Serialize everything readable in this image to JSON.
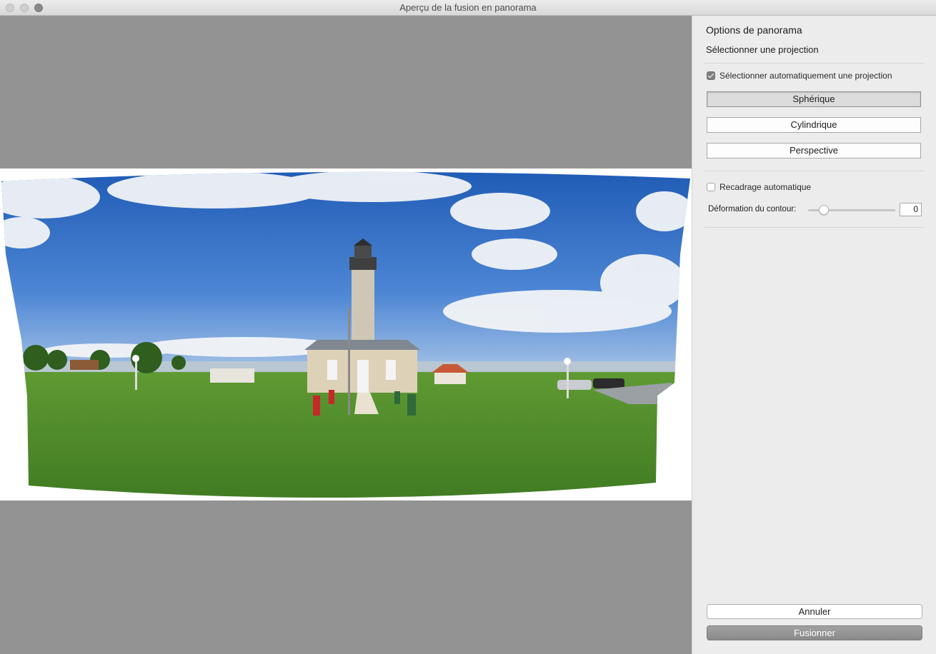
{
  "window": {
    "title": "Aperçu de la fusion en panorama"
  },
  "preview": {
    "image_alt": "Panoramic preview: lighthouse on grassy field under blue sky with clouds"
  },
  "panel": {
    "title": "Options de panorama",
    "subtitle": "Sélectionner une projection",
    "auto_projection": {
      "label": "Sélectionner automatiquement une projection",
      "checked": true
    },
    "projections": [
      {
        "label": "Sphérique",
        "selected": true
      },
      {
        "label": "Cylindrique",
        "selected": false
      },
      {
        "label": "Perspective",
        "selected": false
      }
    ],
    "auto_crop": {
      "label": "Recadrage automatique",
      "checked": false
    },
    "boundary_warp": {
      "label": "Déformation du contour:",
      "value": "0"
    },
    "cancel_label": "Annuler",
    "merge_label": "Fusionner"
  },
  "colors": {
    "preview_bg": "#939393",
    "panel_bg": "#ececec",
    "sky": "#2f6fc4",
    "grass": "#4f8a2a"
  }
}
